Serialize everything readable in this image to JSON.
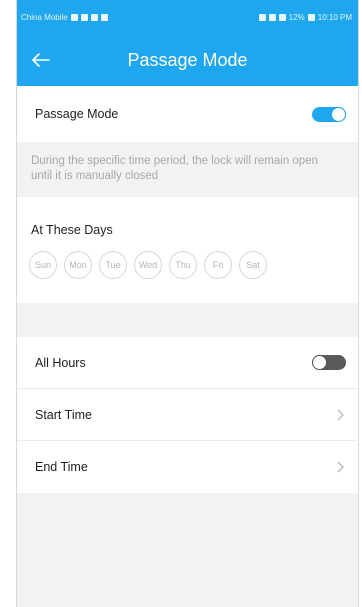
{
  "status_bar": {
    "carrier": "China Mobile",
    "right_text": "12%",
    "time": "10:10 PM"
  },
  "header": {
    "title": "Passage Mode"
  },
  "passage_mode": {
    "label": "Passage Mode",
    "enabled": true,
    "description": "During the specific time period, the lock will remain open until it is manually closed"
  },
  "days": {
    "label": "At These Days",
    "items": [
      "Sun",
      "Mon",
      "Tue",
      "Wed",
      "Thu",
      "Fri",
      "Sat"
    ]
  },
  "schedule": {
    "all_hours_label": "All Hours",
    "all_hours_enabled": false,
    "start_time_label": "Start Time",
    "end_time_label": "End Time"
  },
  "colors": {
    "accent": "#1ea7ee",
    "toggle_off": "#5a5a5a",
    "muted_text": "#a7a7a7"
  },
  "icons": {
    "back": "arrow-left-icon",
    "row_chevron": "chevron-right-icon"
  }
}
